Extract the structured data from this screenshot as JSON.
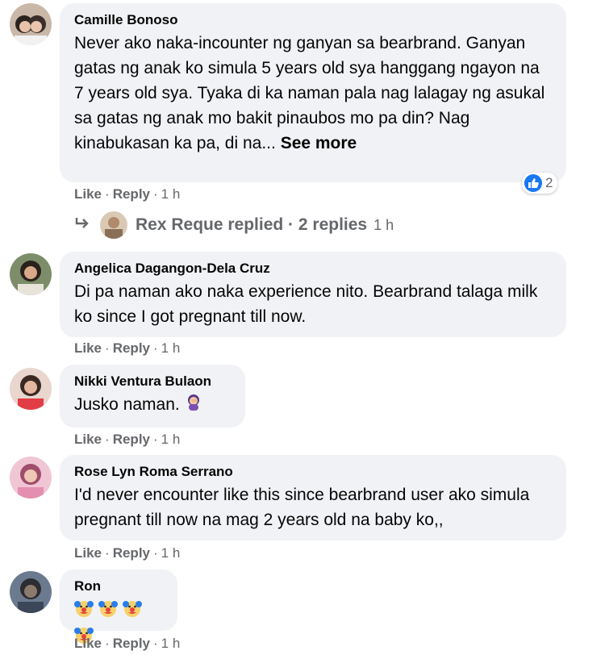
{
  "comments": [
    {
      "author": "Camille Bonoso",
      "text": "Never ako naka-incounter ng ganyan sa bearbrand. Ganyan gatas ng anak ko simula 5 years old sya hanggang ngayon na 7 years old sya. Tyaka di ka naman pala nag lalagay ng asukal sa gatas ng anak mo bakit pinaubos mo pa din? Nag kinabukasan ka pa, di na...",
      "see_more": "See more",
      "like": "Like",
      "reply": "Reply",
      "time": "1 h",
      "reaction_count": "2"
    },
    {
      "author": "Angelica Dagangon-Dela Cruz",
      "text": "Di pa naman ako naka experience nito. Bearbrand talaga milk ko since I got pregnant till now.",
      "like": "Like",
      "reply": "Reply",
      "time": "1 h"
    },
    {
      "author": "Nikki Ventura Bulaon",
      "text": "Jusko naman.",
      "emoji": "woman-facepalming-emoji",
      "like": "Like",
      "reply": "Reply",
      "time": "1 h"
    },
    {
      "author": "Rose Lyn Roma Serrano",
      "text": "I'd never encounter like this since bearbrand user ako simula pregnant till now na mag 2 years old na baby ko,,",
      "like": "Like",
      "reply": "Reply",
      "time": "1 h"
    },
    {
      "author": "Ron",
      "emoji": "clown-face-emoji x4",
      "like": "Like",
      "reply": "Reply",
      "time": "1 h"
    }
  ],
  "replies_summary": {
    "text": "Rex Reque replied · 2 replies",
    "time": "1 h"
  },
  "colors": {
    "bubble": "#f0f2f5",
    "secondary_text": "#65676b",
    "like_blue": "#1877f2"
  }
}
